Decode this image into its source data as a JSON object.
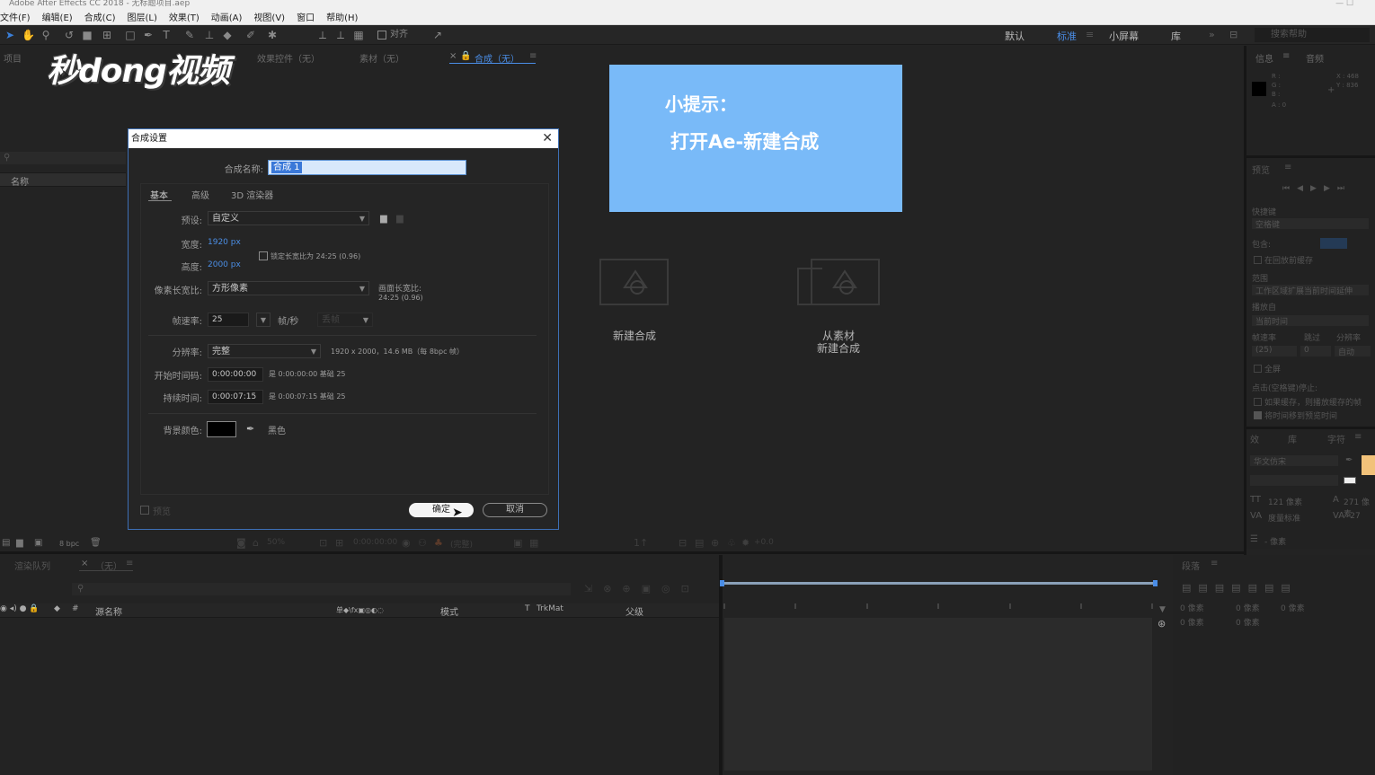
{
  "window": {
    "title": "Adobe After Effects CC 2018 - 无标题项目.aep",
    "controls": "—  ☐"
  },
  "menu": [
    "文件(F)",
    "编辑(E)",
    "合成(C)",
    "图层(L)",
    "效果(T)",
    "动画(A)",
    "视图(V)",
    "窗口",
    "帮助(H)"
  ],
  "toolbar": {
    "align_label": "对齐",
    "workspaces": [
      {
        "label": "默认",
        "active": false
      },
      {
        "label": "标准",
        "active": true
      },
      {
        "label": "小屏幕",
        "active": false
      },
      {
        "label": "库",
        "active": false
      }
    ],
    "search_placeholder": "搜索帮助"
  },
  "logo_text": "秒dong视频",
  "project_panel": {
    "tab": "项目",
    "column_name": "名称",
    "footer_bpc": "8 bpc"
  },
  "viewer_tabs": {
    "effects": "效果控件（无）",
    "footage": "素材（无）",
    "composition": "合成（无）"
  },
  "tip": {
    "line1": "小提示：",
    "line2": "打开Ae-新建合成"
  },
  "comp_actions": {
    "new": "新建合成",
    "from_footage_line1": "从素材",
    "from_footage_line2": "新建合成"
  },
  "viewer_footer": {
    "zoom": "50%",
    "timecode": "0:00:00:00",
    "quality": "(完整)",
    "offset": "+0.0"
  },
  "dialog": {
    "title": "合成设置",
    "name_label": "合成名称:",
    "name_value": "合成 1",
    "tabs": [
      "基本",
      "高级",
      "3D 渲染器"
    ],
    "preset_label": "预设:",
    "preset_value": "自定义",
    "width_label": "宽度:",
    "width_value": "1920 px",
    "height_label": "高度:",
    "height_value": "2000 px",
    "lock_ratio": "锁定长宽比为 24:25 (0.96)",
    "par_label": "像素长宽比:",
    "par_value": "方形像素",
    "frame_ratio_label": "画面长宽比:",
    "frame_ratio_value": "24:25 (0.96)",
    "fps_label": "帧速率:",
    "fps_value": "25",
    "fps_unit": "帧/秒",
    "drop_frame": "丢帧",
    "res_label": "分辨率:",
    "res_value": "完整",
    "res_info": "1920 x 2000，14.6 MB（每 8bpc 帧）",
    "start_label": "开始时间码:",
    "start_value": "0:00:00:00",
    "start_info": "是 0:00:00:00  基础 25",
    "dur_label": "持续时间:",
    "dur_value": "0:00:07:15",
    "dur_info": "是 0:00:07:15  基础 25",
    "bg_label": "背景颜色:",
    "bg_color": "#000000",
    "bg_name": "黑色",
    "preview": "预览",
    "ok": "确定",
    "cancel": "取消"
  },
  "right_panels": {
    "info_tab": "信息",
    "audio_tab": "音频",
    "rgba": [
      "R :",
      "G :",
      "B :",
      "A : 0"
    ],
    "xy": [
      "X : 468",
      "Y : 836"
    ],
    "preview_tab": "预览",
    "shortcut_label": "快捷键",
    "shortcut_value": "空格键",
    "include_label": "包含:",
    "cache_check": "在回放前缓存",
    "range_label": "范围",
    "range_value": "工作区域扩展当前时间延伸",
    "play_from_label": "播放自",
    "play_from_value": "当前时间",
    "fps_hdr": [
      "帧速率",
      "跳过",
      "分辨率"
    ],
    "fps_vals": [
      "(25)",
      "0",
      "自动"
    ],
    "fullscreen": "全屏",
    "on_stop": "点击(空格键)停止:",
    "if_cached": "如果缓存，则播放缓存的帧",
    "move_time": "将时间移到预览时间",
    "effects_tab": "效",
    "library_tab": "库",
    "char_tab": "字符",
    "font_value": "华文仿宋",
    "font_size": "121 像素",
    "leading": "271 像素",
    "tracking": "-27",
    "measure": "度量标准",
    "px_unit": "- 像素",
    "para_tab": "段落",
    "para_vals": [
      "0 像素",
      "0 像素",
      "0 像素",
      "0 像素",
      "0 像素"
    ]
  },
  "timeline": {
    "render_tab": "渲染队列",
    "comp_tab": "（无）",
    "col_layer": "源名称",
    "col_switches": "单◆\\fx▣◎◐◌",
    "col_mode": "模式",
    "col_t": "T",
    "col_trkmat": "TrkMat",
    "col_parent": "父级"
  }
}
